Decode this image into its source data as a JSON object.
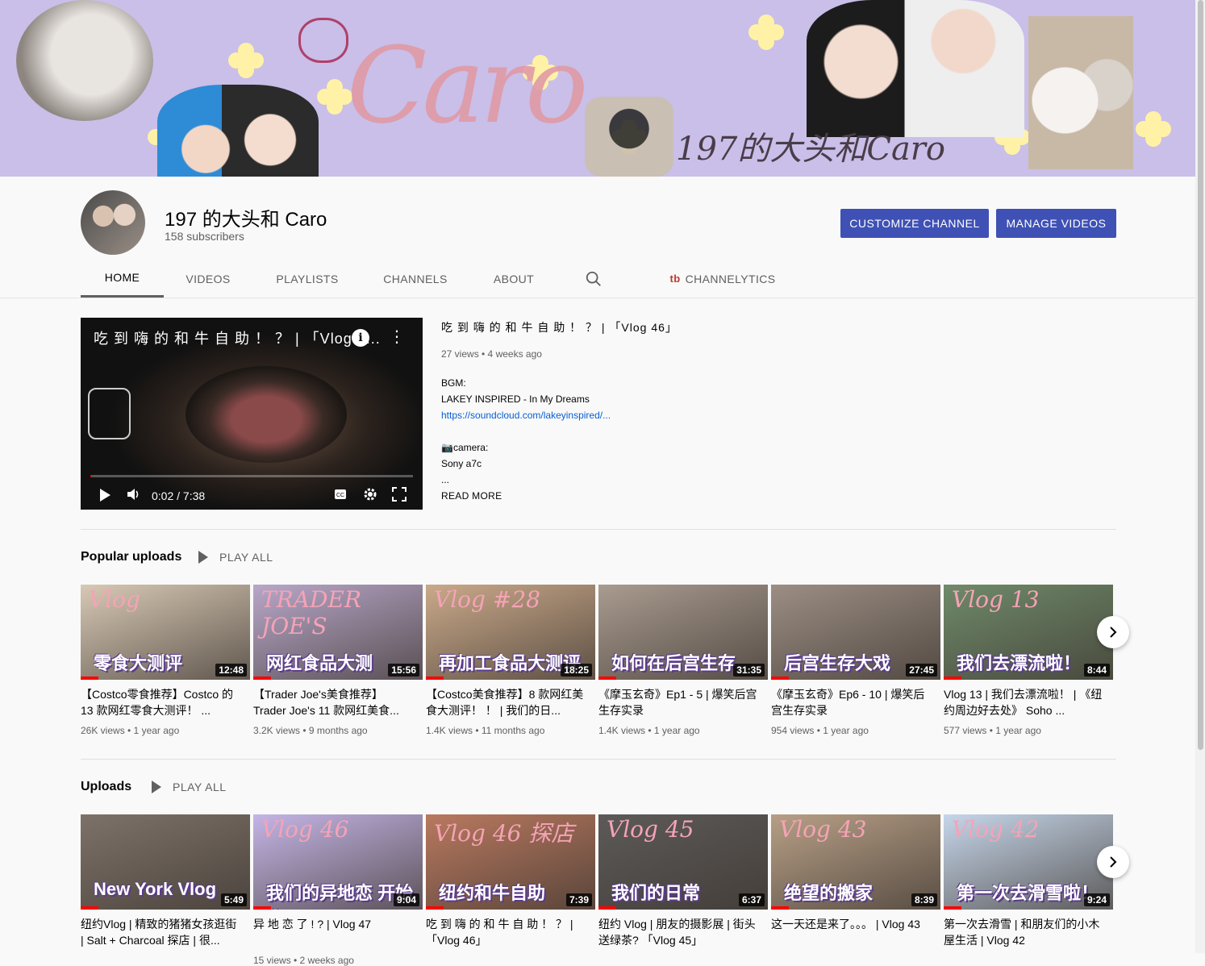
{
  "banner": {
    "script_text": "Caro",
    "subtitle": "197的大头和Caro"
  },
  "channel": {
    "name": "197 的大头和 Caro",
    "subscribers": "158 subscribers",
    "customize_label": "CUSTOMIZE CHANNEL",
    "manage_label": "MANAGE VIDEOS"
  },
  "tabs": [
    {
      "label": "HOME",
      "active": true
    },
    {
      "label": "VIDEOS"
    },
    {
      "label": "PLAYLISTS"
    },
    {
      "label": "CHANNELS"
    },
    {
      "label": "ABOUT"
    },
    {
      "label": "CHANNELYTICS",
      "icon": "tb"
    }
  ],
  "featured": {
    "player_title": "吃 到 嗨 的 和 牛 自 助 ！ ？ | 「Vlog 4...",
    "time_current": "0:02",
    "time_total": "7:38",
    "progress": 0.005,
    "title": "吃 到 嗨 的 和 牛 自 助 ！ ？ | 「Vlog 46」",
    "meta": "27 views • 4 weeks ago",
    "desc_bgm_label": "BGM:",
    "desc_bgm": "LAKEY INSPIRED - In My Dreams",
    "desc_link": "https://soundcloud.com/lakeyinspired/...",
    "desc_camera_label": "📷camera:",
    "desc_camera": "Sony a7c",
    "desc_ellipsis": "...",
    "read_more": "READ MORE"
  },
  "popular": {
    "title": "Popular uploads",
    "play_all": "PLAY ALL",
    "videos": [
      {
        "title": "【Costco零食推荐】Costco 的 13 款网红零食大测评！ ...",
        "meta": "26K views • 1 year ago",
        "duration": "12:48",
        "thumb_text": "零食大测评",
        "thumb_script": "Vlog",
        "thumb_bg": "#d8c9b5"
      },
      {
        "title": "【Trader Joe's美食推荐】 Trader Joe's 11 款网红美食...",
        "meta": "3.2K views • 9 months ago",
        "duration": "15:56",
        "thumb_text": "网红食品大测",
        "thumb_script": "TRADER JOE'S",
        "thumb_bg": "#b8a7c9"
      },
      {
        "title": "【Costco美食推荐】8 款网红美食大测评！ ！ | 我们的日...",
        "meta": "1.4K views • 11 months ago",
        "duration": "18:25",
        "thumb_text": "再加工食品大测评",
        "thumb_script": "Vlog #28",
        "thumb_bg": "#caa98a"
      },
      {
        "title": "《摩玉玄奇》Ep1 - 5 | 爆笑后宫生存实录",
        "meta": "1.4K views • 1 year ago",
        "duration": "31:35",
        "thumb_text": "如何在后宫生存",
        "thumb_script": "",
        "thumb_bg": "#a99b8f"
      },
      {
        "title": "《摩玉玄奇》Ep6 - 10 | 爆笑后宫生存实录",
        "meta": "954 views • 1 year ago",
        "duration": "27:45",
        "thumb_text": "后宫生存大戏",
        "thumb_script": "",
        "thumb_bg": "#9c8e84"
      },
      {
        "title": "Vlog 13 | 我们去漂流啦！ | 《纽约周边好去处》 Soho ...",
        "meta": "577 views • 1 year ago",
        "duration": "8:44",
        "thumb_text": "我们去漂流啦！",
        "thumb_script": "Vlog 13",
        "thumb_bg": "#6f8a6a"
      }
    ]
  },
  "uploads": {
    "title": "Uploads",
    "play_all": "PLAY ALL",
    "videos": [
      {
        "title": "纽约Vlog | 精致的猪猪女孩逛街 | Salt + Charcoal 探店 | 很...",
        "meta": "",
        "duration": "5:49",
        "thumb_text": "New York Vlog",
        "thumb_script": "",
        "thumb_bg": "#7d7269"
      },
      {
        "title": "异 地 恋 了 ! ? | Vlog 47",
        "meta": "15 views • 2 weeks ago",
        "duration": "9:04",
        "thumb_text": "我们的异地恋 开始啦",
        "thumb_script": "Vlog 46",
        "thumb_bg": "#c4b5e6"
      },
      {
        "title": "吃 到 嗨 的 和 牛 自 助 ！ ？ | 「Vlog 46」",
        "meta": "",
        "duration": "7:39",
        "thumb_text": "纽约和牛自助",
        "thumb_script": "Vlog 46 探店",
        "thumb_bg": "#b9795f"
      },
      {
        "title": "纽约 Vlog | 朋友的摄影展 | 街头送绿茶? 「Vlog 45」",
        "meta": "",
        "duration": "6:37",
        "thumb_text": "我们的日常",
        "thumb_script": "Vlog 45",
        "thumb_bg": "#5c5a58"
      },
      {
        "title": "这一天还是来了。。。 | Vlog 43",
        "meta": "",
        "duration": "8:39",
        "thumb_text": "绝望的搬家",
        "thumb_script": "Vlog 43",
        "thumb_bg": "#b79f86"
      },
      {
        "title": "第一次去滑雪 | 和朋友们的小木屋生活 | Vlog 42",
        "meta": "",
        "duration": "9:24",
        "thumb_text": "第一次去滑雪啦！",
        "thumb_script": "Vlog 42",
        "thumb_bg": "#c6d6ea"
      }
    ]
  }
}
